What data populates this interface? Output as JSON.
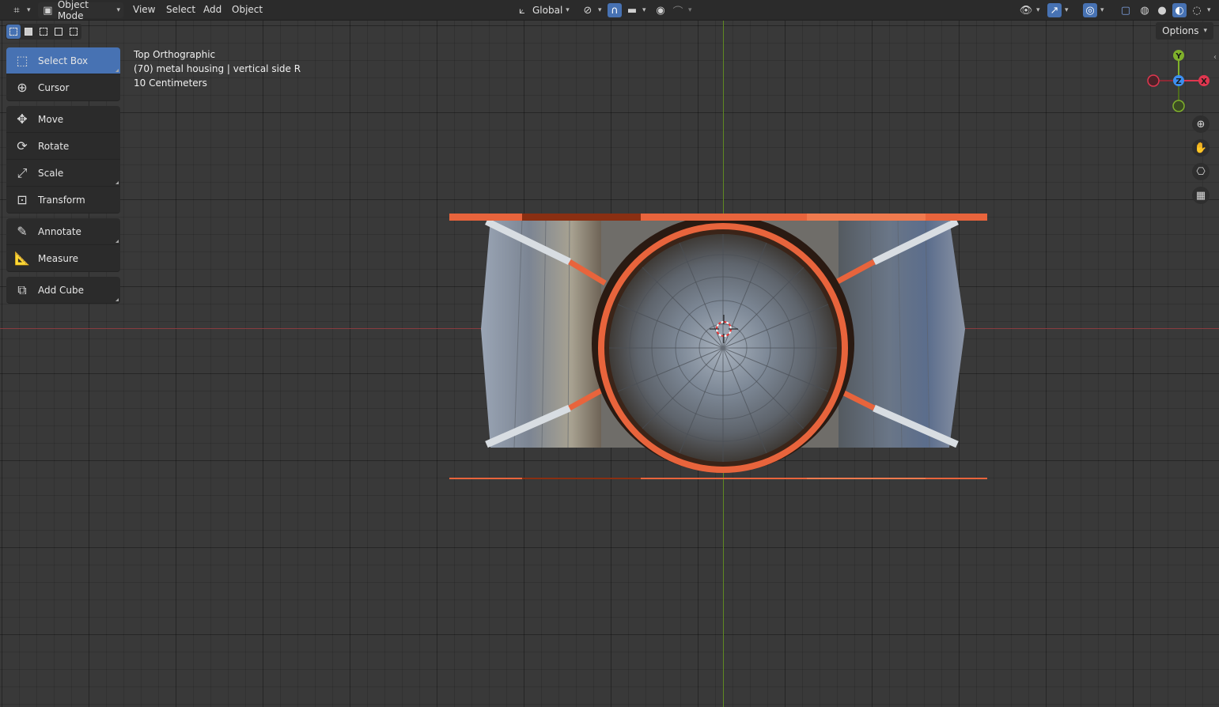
{
  "header": {
    "mode": "Object Mode",
    "menus": [
      "View",
      "Select",
      "Add",
      "Object"
    ],
    "orientation": "Global"
  },
  "toolbar": {
    "tools": [
      {
        "label": "Select Box",
        "icon": "select-box-icon"
      },
      {
        "label": "Cursor",
        "icon": "cursor-icon"
      },
      {
        "label": "Move",
        "icon": "move-icon"
      },
      {
        "label": "Rotate",
        "icon": "rotate-icon"
      },
      {
        "label": "Scale",
        "icon": "scale-icon"
      },
      {
        "label": "Transform",
        "icon": "transform-icon"
      },
      {
        "label": "Annotate",
        "icon": "annotate-icon"
      },
      {
        "label": "Measure",
        "icon": "measure-icon"
      },
      {
        "label": "Add Cube",
        "icon": "add-cube-icon"
      }
    ]
  },
  "viewport": {
    "view_name": "Top Orthographic",
    "object_info": "(70) metal housing | vertical side R",
    "scale_info": "10 Centimeters",
    "options_label": "Options"
  },
  "gizmo": {
    "y": "Y",
    "z": "Z",
    "x": "X"
  },
  "colors": {
    "accent": "#4772b3",
    "selection_outline": "#e8643c",
    "x_axis": "#e0364f",
    "y_axis": "#7fb02b",
    "z_axis": "#3d8ff0"
  }
}
